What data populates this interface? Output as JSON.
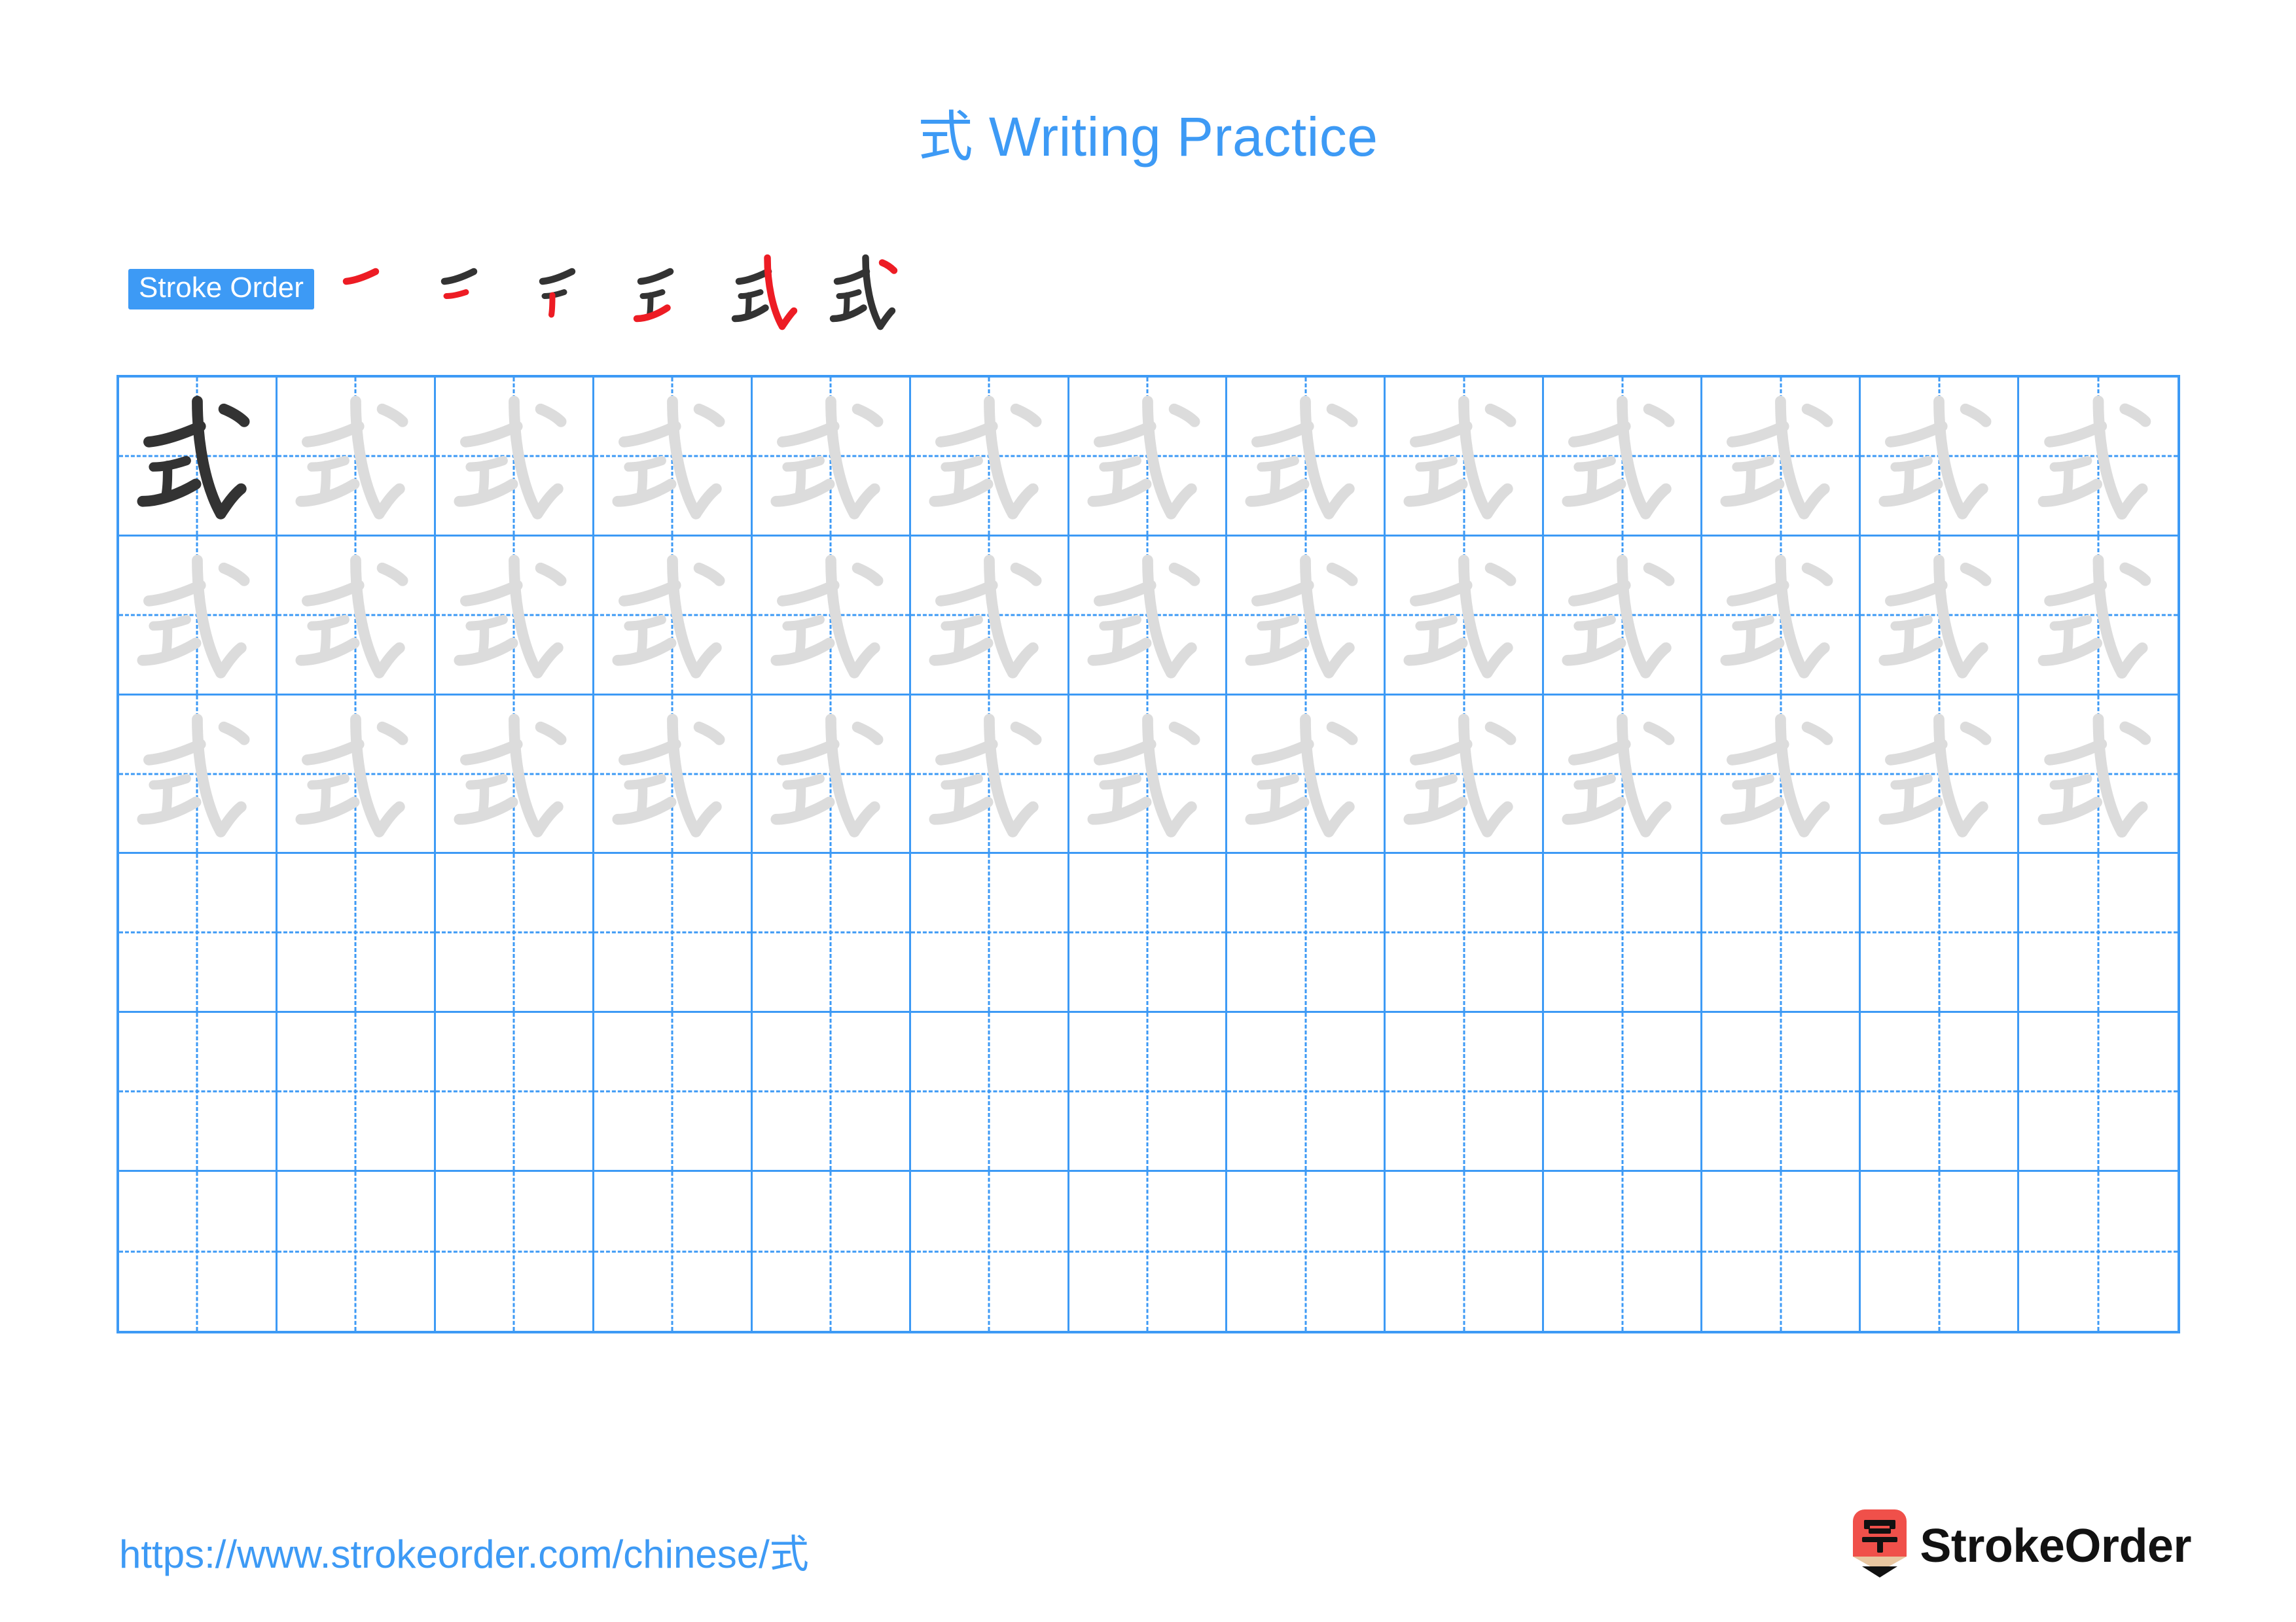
{
  "character": "式",
  "page": {
    "title": "式 Writing Practice",
    "background_color": "#ffffff"
  },
  "colors": {
    "accent_blue": "#3d9af5",
    "grid_line": "#3d9af5",
    "trace_gray": "#dcdcdc",
    "ink_black": "#333333",
    "highlight_red": "#ed1c24",
    "logo_red": "#f0504a",
    "logo_wood": "#e8c6a0"
  },
  "stroke_order": {
    "badge_label": "Stroke Order",
    "stroke_count": 6,
    "steps": [
      {
        "index": 1,
        "name": "stroke-step-1",
        "new_stroke": "heng",
        "drawn": 1
      },
      {
        "index": 2,
        "name": "stroke-step-2",
        "new_stroke": "heng",
        "drawn": 2
      },
      {
        "index": 3,
        "name": "stroke-step-3",
        "new_stroke": "shu",
        "drawn": 3
      },
      {
        "index": 4,
        "name": "stroke-step-4",
        "new_stroke": "ti",
        "drawn": 4
      },
      {
        "index": 5,
        "name": "stroke-step-5",
        "new_stroke": "xiegou",
        "drawn": 5
      },
      {
        "index": 6,
        "name": "stroke-step-6",
        "new_stroke": "dian",
        "drawn": 6
      }
    ]
  },
  "practice_grid": {
    "columns": 13,
    "rows": 6,
    "guide_style": "dashed-crosshair",
    "rows_data": [
      {
        "row": 1,
        "cells": [
          "dark",
          "trace",
          "trace",
          "trace",
          "trace",
          "trace",
          "trace",
          "trace",
          "trace",
          "trace",
          "trace",
          "trace",
          "trace"
        ]
      },
      {
        "row": 2,
        "cells": [
          "trace",
          "trace",
          "trace",
          "trace",
          "trace",
          "trace",
          "trace",
          "trace",
          "trace",
          "trace",
          "trace",
          "trace",
          "trace"
        ]
      },
      {
        "row": 3,
        "cells": [
          "trace",
          "trace",
          "trace",
          "trace",
          "trace",
          "trace",
          "trace",
          "trace",
          "trace",
          "trace",
          "trace",
          "trace",
          "trace"
        ]
      },
      {
        "row": 4,
        "cells": [
          "empty",
          "empty",
          "empty",
          "empty",
          "empty",
          "empty",
          "empty",
          "empty",
          "empty",
          "empty",
          "empty",
          "empty",
          "empty"
        ]
      },
      {
        "row": 5,
        "cells": [
          "empty",
          "empty",
          "empty",
          "empty",
          "empty",
          "empty",
          "empty",
          "empty",
          "empty",
          "empty",
          "empty",
          "empty",
          "empty"
        ]
      },
      {
        "row": 6,
        "cells": [
          "empty",
          "empty",
          "empty",
          "empty",
          "empty",
          "empty",
          "empty",
          "empty",
          "empty",
          "empty",
          "empty",
          "empty",
          "empty"
        ]
      }
    ]
  },
  "footer": {
    "url": "https://www.strokeorder.com/chinese/式",
    "logo_text": "StrokeOrder",
    "logo_character": "字"
  }
}
